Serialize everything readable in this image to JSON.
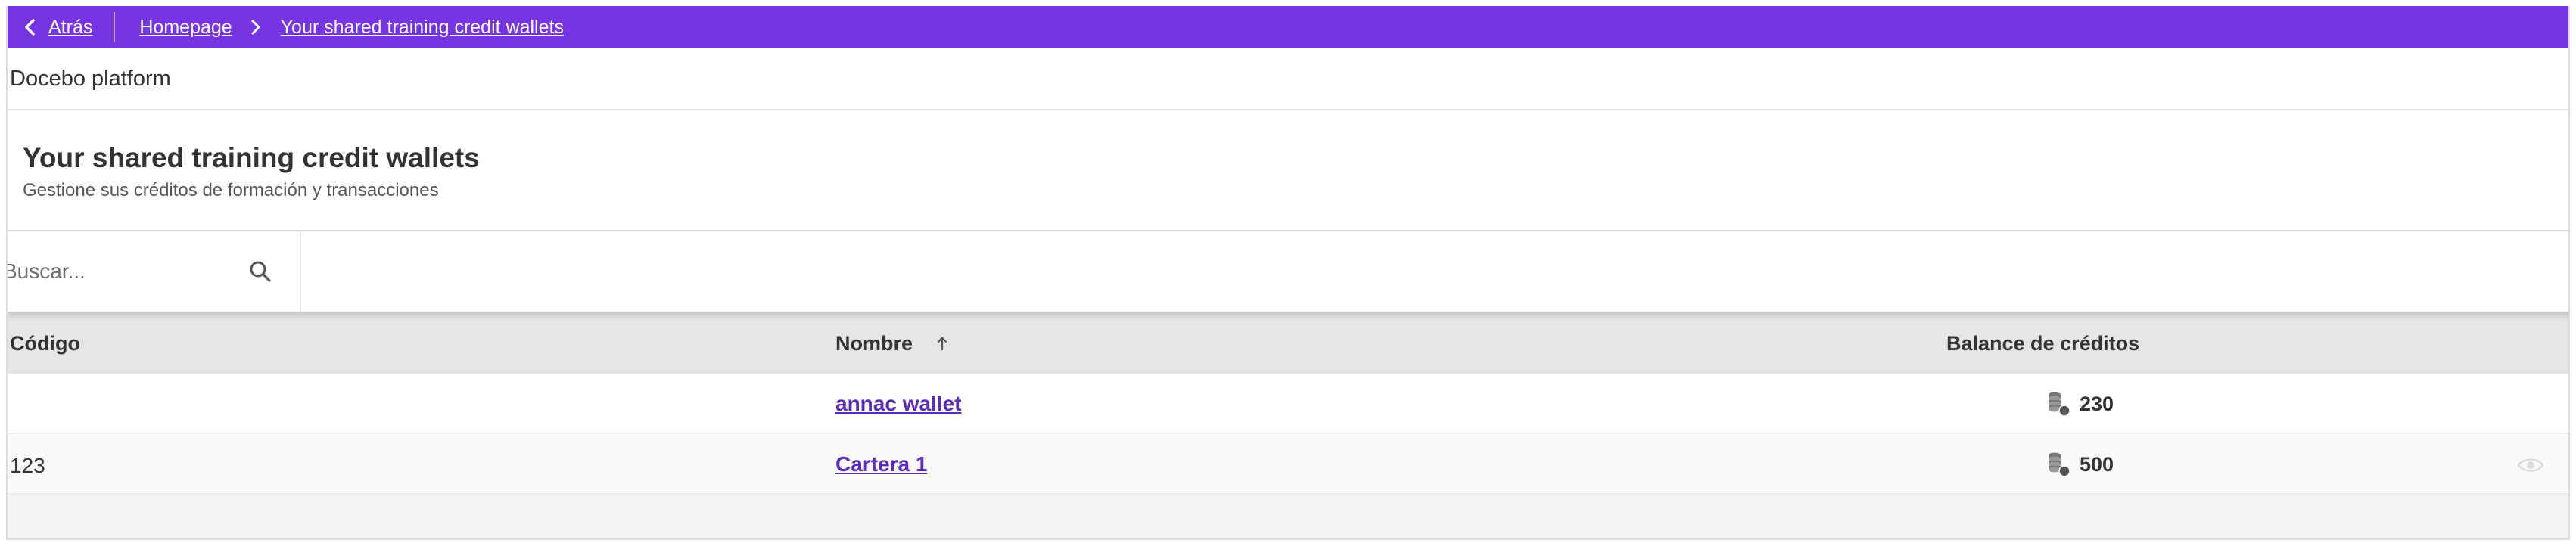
{
  "breadcrumb": {
    "back_label": "Atrás",
    "items": [
      "Homepage",
      "Your shared training credit wallets"
    ]
  },
  "platform_name": "Docebo platform",
  "header": {
    "title": "Your shared training credit wallets",
    "subtitle": "Gestione sus créditos de formación y transacciones"
  },
  "search": {
    "placeholder": "Buscar...",
    "value": ""
  },
  "table": {
    "columns": {
      "code": "Código",
      "name": "Nombre",
      "balance": "Balance de créditos"
    },
    "sort": {
      "column": "name",
      "direction": "asc"
    },
    "rows": [
      {
        "code": "",
        "name": "annac wallet",
        "balance": "230"
      },
      {
        "code": "123",
        "name": "Cartera 1",
        "balance": "500"
      }
    ]
  },
  "colors": {
    "topbar": "#7634e2",
    "link": "#5b2bbd",
    "table_header": "#e4e5e5"
  },
  "icons": [
    "chevron-left-icon",
    "chevron-right-icon",
    "search-icon",
    "arrow-up-icon",
    "coins-icon",
    "eye-icon"
  ]
}
